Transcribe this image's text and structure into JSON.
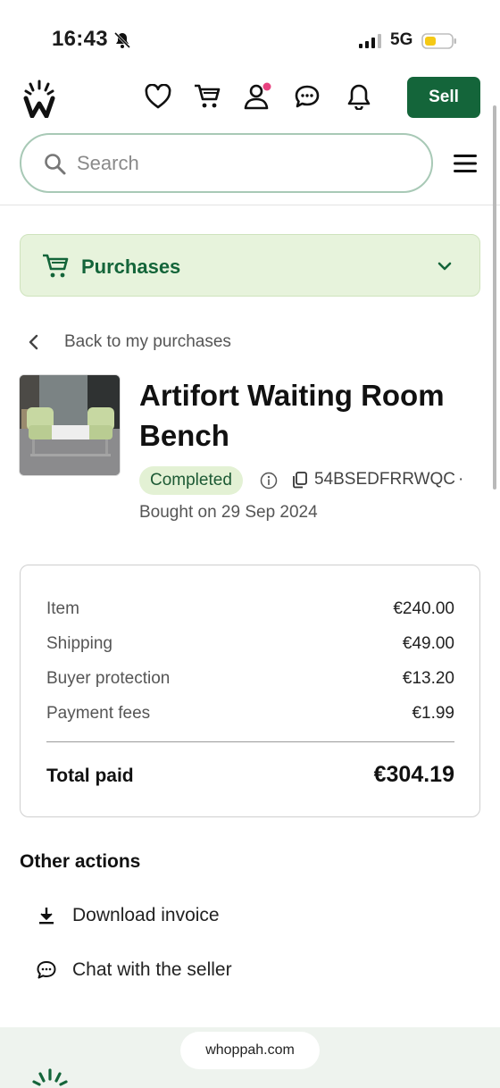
{
  "status_bar": {
    "time": "16:43",
    "network": "5G"
  },
  "header": {
    "sell_label": "Sell"
  },
  "search": {
    "placeholder": "Search"
  },
  "section": {
    "label": "Purchases"
  },
  "back_link": {
    "label": "Back to my purchases"
  },
  "product": {
    "title": "Artifort Waiting Room Bench",
    "status": "Completed",
    "order_id": "54BSEDFRRWQC",
    "separator": "·",
    "bought_on": "Bought on 29 Sep 2024"
  },
  "summary": {
    "rows": [
      {
        "label": "Item",
        "value": "€240.00"
      },
      {
        "label": "Shipping",
        "value": "€49.00"
      },
      {
        "label": "Buyer protection",
        "value": "€13.20"
      },
      {
        "label": "Payment fees",
        "value": "€1.99"
      }
    ],
    "total_label": "Total paid",
    "total_value": "€304.19"
  },
  "other_actions": {
    "heading": "Other actions",
    "items": [
      {
        "label": "Download invoice",
        "icon": "download-icon"
      },
      {
        "label": "Chat with the seller",
        "icon": "chat-icon"
      }
    ]
  },
  "footer": {
    "url": "whoppah.com"
  },
  "colors": {
    "brand_green": "#14653a",
    "badge_bg": "#e3f1d4",
    "section_bg": "#e7f3dc",
    "notification_dot": "#e8417f"
  }
}
